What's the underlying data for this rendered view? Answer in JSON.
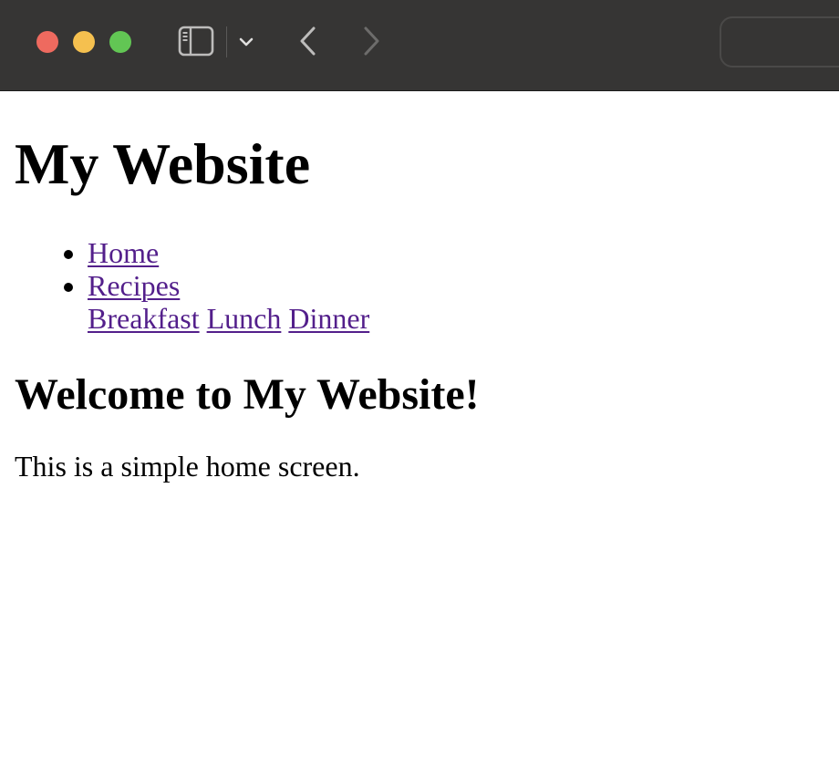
{
  "browser": {
    "controls": {
      "close_color": "#ee6a5f",
      "minimize_color": "#f5c04f",
      "zoom_color": "#62c654"
    },
    "icons": [
      "sidebar-icon",
      "chevron-down-icon",
      "back-arrow-icon",
      "forward-arrow-icon"
    ],
    "address_bar": {
      "value": ""
    }
  },
  "page": {
    "title": "My Website",
    "nav": {
      "home": "Home",
      "recipes": "Recipes",
      "submenu": [
        "Breakfast",
        "Lunch",
        "Dinner"
      ]
    },
    "welcome_heading": "Welcome to My Website!",
    "intro": "This is a simple home screen."
  },
  "colors": {
    "link_visited": "#531f8b",
    "toolbar_bg": "#363534"
  }
}
